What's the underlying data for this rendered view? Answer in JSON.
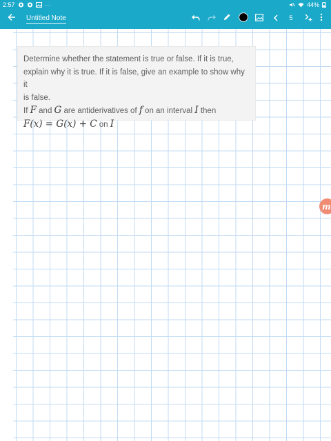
{
  "status_bar": {
    "time": "2:57",
    "more": "···",
    "battery": "44%"
  },
  "app_bar": {
    "note_title": "Untitled Note",
    "page_number": "5"
  },
  "question": {
    "line1": "Determine whether the statement is true or false. If it is true,",
    "line2": "explain why it is true. If it is false, give an example to show why it",
    "line3": "is false.",
    "l4_if": "If ",
    "F": "F",
    "l4_and": " and ",
    "G": "G",
    "l4_are": " are antiderivatives of ",
    "f": "f",
    "l4_on": " on an interval ",
    "I": "I",
    "l4_then": " then",
    "equation": "F(x) = G(x) + C",
    "l5_on": " on ",
    "I2": "I"
  },
  "side_badge": {
    "label": "m"
  },
  "colors": {
    "accent": "#1aa9c9",
    "grid": "#c2dbf3",
    "card": "#f3f3f3",
    "badge": "#f08c74"
  }
}
